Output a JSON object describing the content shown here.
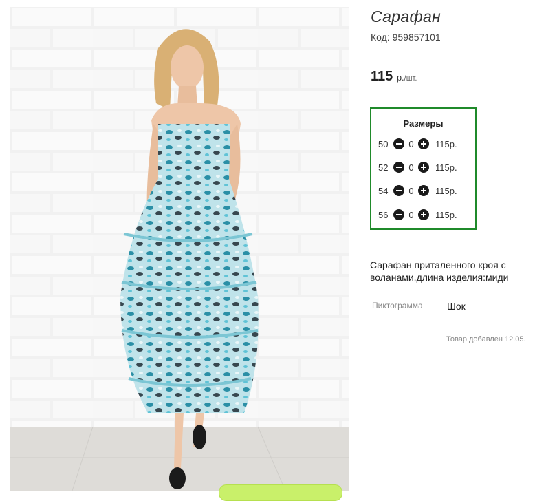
{
  "product": {
    "title": "Сарафан",
    "code": "Код: 959857101",
    "price_value": "115",
    "price_unit": "р.",
    "price_per": "/шт.",
    "description": "Сарафан приталенного кроя с воланами,длина изделия:миди"
  },
  "sizes": {
    "header": "Размеры",
    "rows": [
      {
        "size": "50",
        "qty": "0",
        "price": "115р."
      },
      {
        "size": "52",
        "qty": "0",
        "price": "115р."
      },
      {
        "size": "54",
        "qty": "0",
        "price": "115р."
      },
      {
        "size": "56",
        "qty": "0",
        "price": "115р."
      }
    ]
  },
  "attributes": {
    "label": "Пиктограмма",
    "value": "Шок"
  },
  "added_text": "Товар добавлен 12.05.",
  "colors": {
    "sizes_border": "#1f8a2a",
    "cart_button": "#c9f06a"
  },
  "icons": {
    "minus": "minus-circle-icon",
    "plus": "plus-circle-icon"
  }
}
